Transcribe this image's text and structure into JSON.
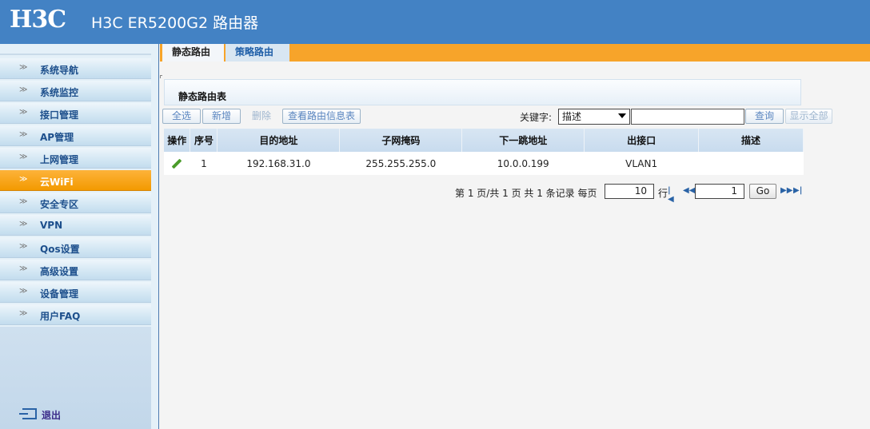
{
  "header": {
    "logo": "H3C",
    "title": "H3C ER5200G2 路由器"
  },
  "sidebar": {
    "items": [
      {
        "label": "系统导航"
      },
      {
        "label": "系统监控"
      },
      {
        "label": "接口管理"
      },
      {
        "label": "AP管理"
      },
      {
        "label": "上网管理"
      },
      {
        "label": "云WiFi",
        "active": true
      },
      {
        "label": "安全专区"
      },
      {
        "label": "VPN"
      },
      {
        "label": "Qos设置"
      },
      {
        "label": "高级设置"
      },
      {
        "label": "设备管理"
      },
      {
        "label": "用户FAQ"
      }
    ],
    "logout_label": "退出",
    "bullet": "≫"
  },
  "tabs": [
    {
      "label": "静态路由",
      "active": true
    },
    {
      "label": "策略路由"
    }
  ],
  "panel": {
    "title": "静态路由表"
  },
  "toolbar": {
    "select_all": "全选",
    "add": "新增",
    "delete": "删除",
    "view_route": "查看路由信息表",
    "keyword_label": "关键字:",
    "keyword_selected": "描述",
    "keyword_value": "",
    "query": "查询",
    "show_all": "显示全部"
  },
  "table": {
    "columns": [
      "操作",
      "序号",
      "目的地址",
      "子网掩码",
      "下一跳地址",
      "出接口",
      "描述"
    ],
    "rows": [
      {
        "index": "1",
        "dest": "192.168.31.0",
        "mask": "255.255.255.0",
        "next_hop": "10.0.0.199",
        "iface": "VLAN1",
        "desc": ""
      }
    ]
  },
  "pager": {
    "summary": "第 1 页/共 1 页 共 1 条记录 每页",
    "per_page": "10",
    "rows_unit": "行",
    "page_input": "1",
    "go": "Go"
  },
  "colors": {
    "header": "#4382c4",
    "accent": "#f7a42a",
    "active_nav": "#f39a00"
  }
}
